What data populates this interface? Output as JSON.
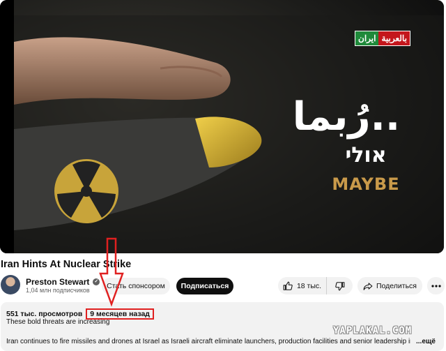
{
  "video": {
    "logo_text_green": "ايران",
    "logo_text_red": "بالعربية",
    "caption_arabic": "رُبما..",
    "caption_hebrew": "אולי",
    "caption_english": "MAYBE"
  },
  "title": "Iran Hints At Nuclear Strike",
  "channel": {
    "name": "Preston Stewart",
    "subscribers": "1,04 млн подписчиков",
    "sponsor_label": "Стать спонсором",
    "subscribe_label": "Подписаться"
  },
  "actions": {
    "likes": "18 тыс.",
    "share_label": "Поделиться"
  },
  "description": {
    "views": "551 тыс. просмотров",
    "time_ago": "9 месяцев назад",
    "tagline": "These bold threats are increasing",
    "body": "Iran continues to fire missiles and drones at Israel as Israeli aircraft eliminate launchers, production facilities and senior leadership in Iran.",
    "more_label": "...ещё"
  },
  "watermark": "YAPLAKAL.COM",
  "colors": {
    "annotation_red": "#e02020",
    "subscribe_bg": "#0f0f0f",
    "pill_bg": "#f2f2f2"
  }
}
